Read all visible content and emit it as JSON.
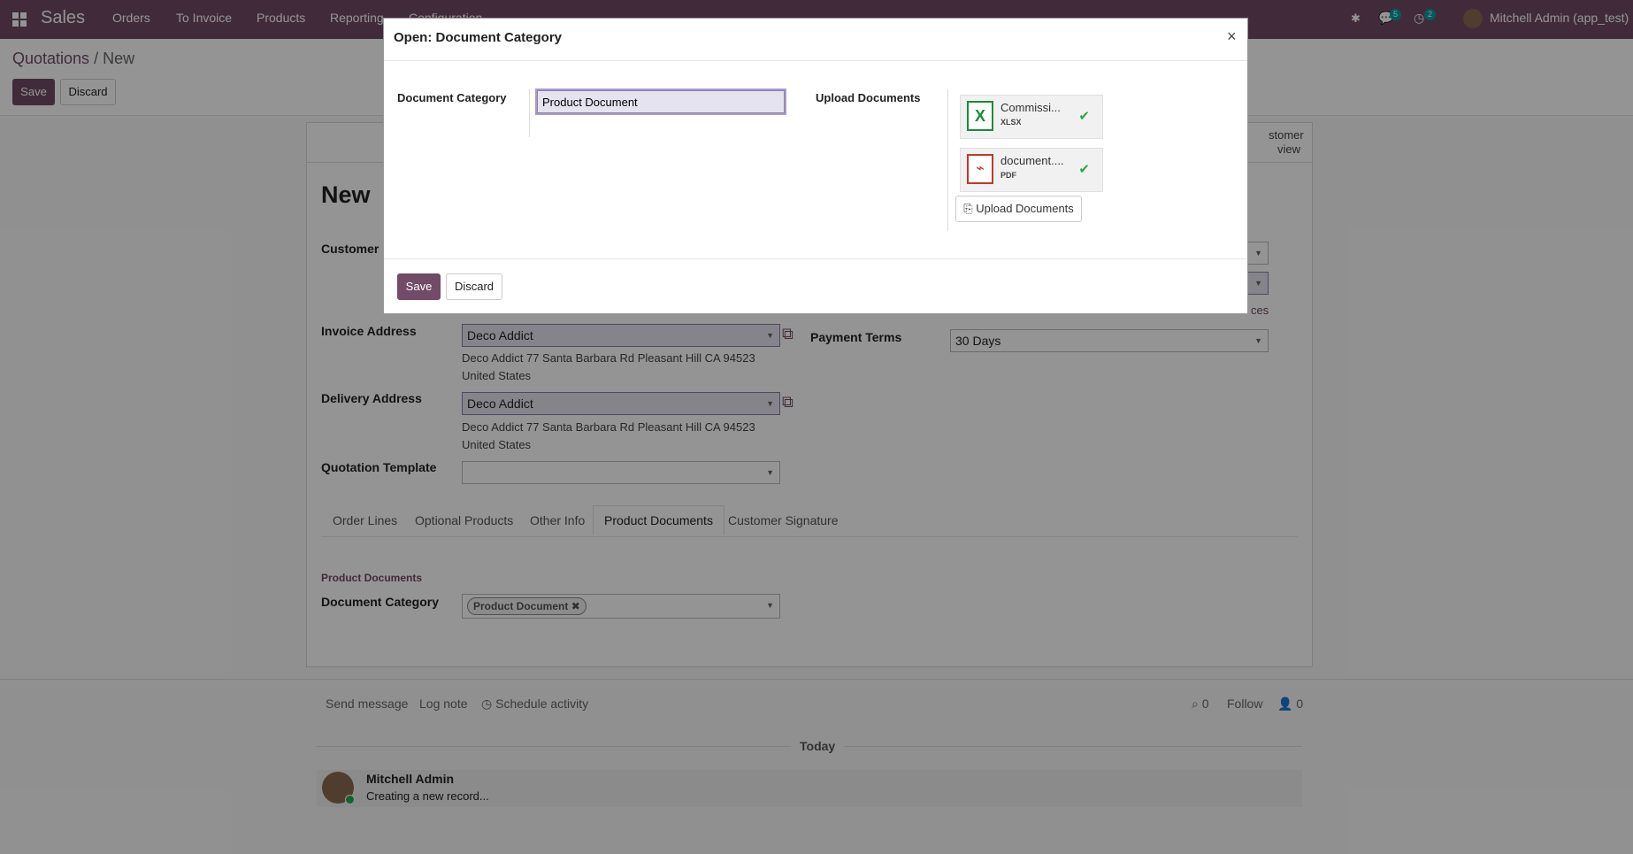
{
  "topnav": {
    "app": "Sales",
    "menu": [
      "Orders",
      "To Invoice",
      "Products",
      "Reporting",
      "Configuration"
    ],
    "messages_badge": "5",
    "activities_badge": "2",
    "user": "Mitchell Admin (app_test)"
  },
  "control": {
    "breadcrumb_parent": "Quotations",
    "breadcrumb_sep": "/",
    "breadcrumb_current": "New",
    "save": "Save",
    "discard": "Discard"
  },
  "form": {
    "title": "New",
    "customer_label": "Customer",
    "invoice_address_label": "Invoice Address",
    "invoice_address_value": "Deco Addict",
    "invoice_address_line1": "Deco Addict 77 Santa Barbara Rd Pleasant Hill CA 94523",
    "invoice_address_line2": "United States",
    "delivery_address_label": "Delivery Address",
    "delivery_address_value": "Deco Addict",
    "delivery_address_line1": "Deco Addict 77 Santa Barbara Rd Pleasant Hill CA 94523",
    "delivery_address_line2": "United States",
    "quotation_template_label": "Quotation Template",
    "payment_terms_label": "Payment Terms",
    "payment_terms_value": "30 Days",
    "pricelist_fragment": "ces",
    "customer_preview_1": "stomer",
    "customer_preview_2": "view",
    "tabs": [
      "Order Lines",
      "Optional Products",
      "Other Info",
      "Product Documents",
      "Customer Signature"
    ],
    "section_title": "Product Documents",
    "doc_category_label": "Document Category",
    "doc_category_tag": "Product Document"
  },
  "chatter": {
    "send_message": "Send message",
    "log_note": "Log note",
    "schedule_activity": "Schedule activity",
    "attachments_count": "0",
    "follow": "Follow",
    "followers_count": "0",
    "today": "Today",
    "author": "Mitchell Admin",
    "message": "Creating a new record..."
  },
  "modal": {
    "title": "Open: Document Category",
    "close": "×",
    "doc_category_label": "Document Category",
    "doc_category_value": "Product Document",
    "upload_label": "Upload Documents",
    "files": [
      {
        "name": "Commissi...",
        "type": "XLSX",
        "icon": "X"
      },
      {
        "name": "document....",
        "type": "PDF",
        "icon": "pdf"
      }
    ],
    "upload_button": "Upload Documents",
    "save": "Save",
    "discard": "Discard"
  },
  "colors": {
    "brand": "#714B67",
    "badge": "#00A09D",
    "xlsx": "#1D8A3C",
    "pdf": "#C0392B",
    "check": "#28a745"
  }
}
